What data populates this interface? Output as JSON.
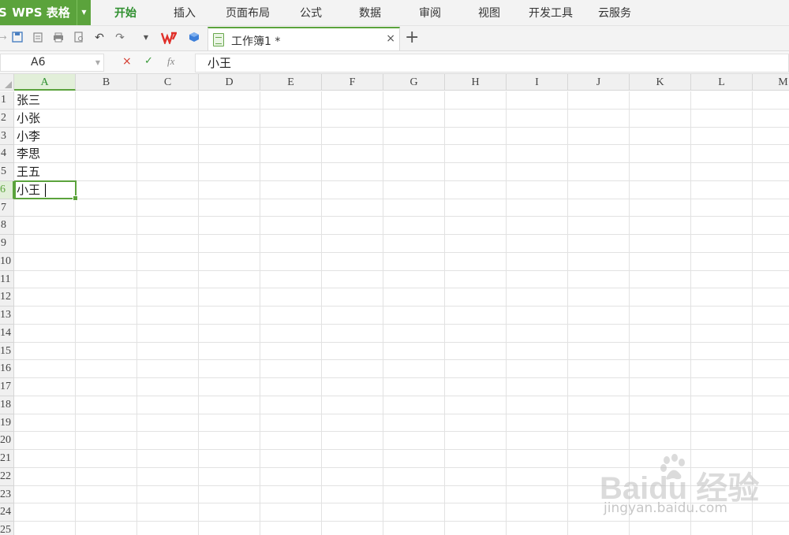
{
  "app": {
    "prefix": "S",
    "name": "WPS 表格",
    "dropdown": "▼"
  },
  "menu": [
    "开始",
    "插入",
    "页面布局",
    "公式",
    "数据",
    "审阅",
    "视图",
    "开发工具",
    "云服务"
  ],
  "document_tab": {
    "title": "工作簿1 *",
    "close": "×",
    "new": "+"
  },
  "formula_bar": {
    "name_box": "A6",
    "cancel": "×",
    "confirm": "✓",
    "fx": "fx",
    "content": "小王"
  },
  "columns": [
    "A",
    "B",
    "C",
    "D",
    "E",
    "F",
    "G",
    "H",
    "I",
    "J",
    "K",
    "L",
    "M"
  ],
  "rows": [
    "1",
    "2",
    "3",
    "4",
    "5",
    "6",
    "7",
    "8",
    "9",
    "10",
    "11",
    "12",
    "13",
    "14",
    "15",
    "16",
    "17",
    "18",
    "19",
    "20",
    "21",
    "22",
    "23",
    "24",
    "25"
  ],
  "cells_A": [
    "张三",
    "小张",
    "小李",
    "李思",
    "王五",
    "小王"
  ],
  "selected": {
    "column": "A",
    "row": "6"
  },
  "watermark": {
    "brand": "Baidu 经验",
    "url": "jingyan.baidu.com"
  },
  "colors": {
    "accent": "#5ba33c",
    "active_menu": "#2e8f2e"
  }
}
